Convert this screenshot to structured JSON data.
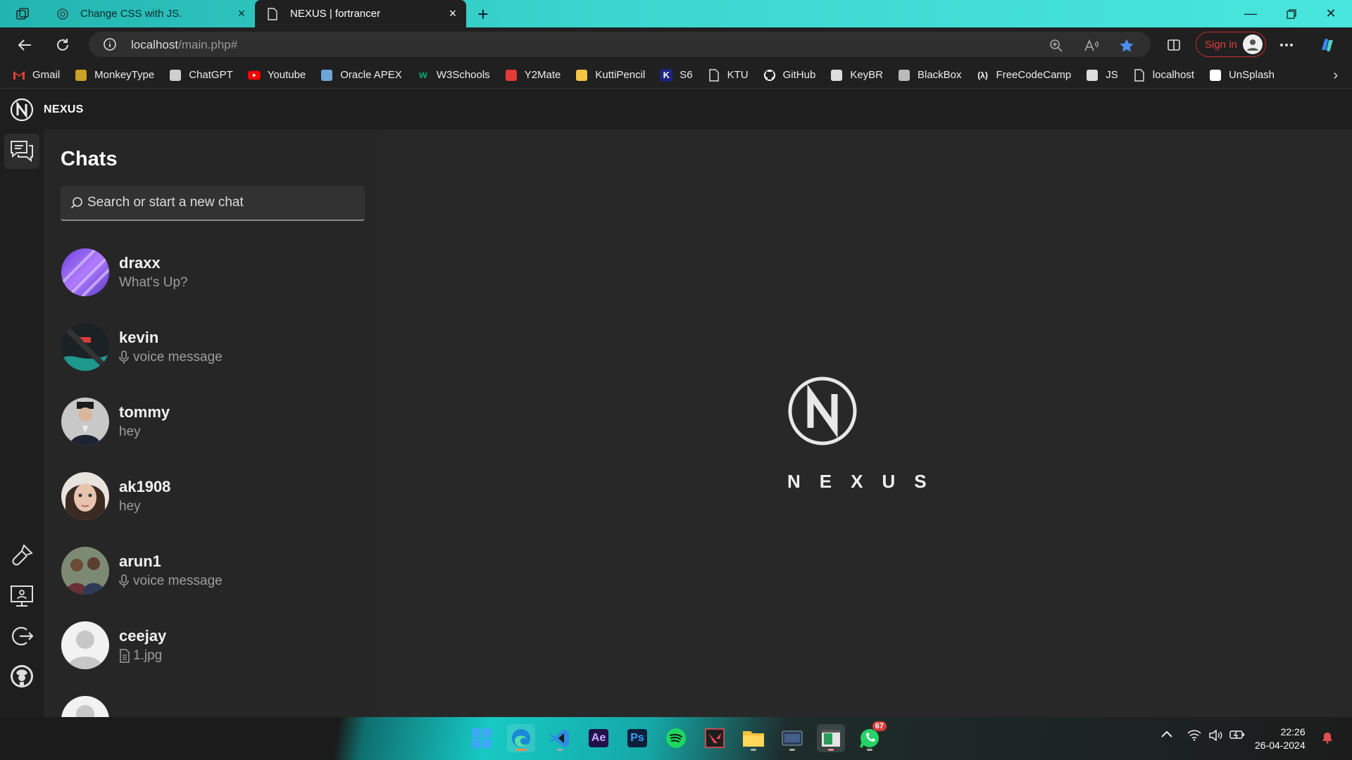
{
  "browser": {
    "tabs": [
      {
        "title": "Change CSS with JS.",
        "favicon": "chatgpt-icon"
      },
      {
        "title": "NEXUS | fortrancer",
        "favicon": "page-icon"
      }
    ],
    "url_host": "localhost",
    "url_path": "/main.php#",
    "signin_label": "Sign in",
    "bookmarks": [
      {
        "label": "Gmail",
        "icon": "gmail-icon",
        "color": "#ea4335"
      },
      {
        "label": "MonkeyType",
        "icon": "monkeytype-icon",
        "color": "#c9a227"
      },
      {
        "label": "ChatGPT",
        "icon": "chatgpt-icon",
        "color": "#cfcfcf"
      },
      {
        "label": "Youtube",
        "icon": "youtube-icon",
        "color": "#ff0000"
      },
      {
        "label": "Oracle APEX",
        "icon": "oracle-apex-icon",
        "color": "#6aa6d8"
      },
      {
        "label": "W3Schools",
        "icon": "w3schools-icon",
        "color": "#04aa6d"
      },
      {
        "label": "Y2Mate",
        "icon": "y2mate-icon",
        "color": "#e53935"
      },
      {
        "label": "KuttiPencil",
        "icon": "pencil-icon",
        "color": "#f4c542"
      },
      {
        "label": "S6",
        "icon": "k-icon",
        "color": "#1a237e"
      },
      {
        "label": "KTU",
        "icon": "page-icon",
        "color": "#dddddd"
      },
      {
        "label": "GitHub",
        "icon": "github-icon",
        "color": "#ffffff"
      },
      {
        "label": "KeyBR",
        "icon": "keybr-icon",
        "color": "#dddddd"
      },
      {
        "label": "BlackBox",
        "icon": "blackbox-icon",
        "color": "#bbbbbb"
      },
      {
        "label": "FreeCodeCamp",
        "icon": "freecodecamp-icon",
        "color": "#ffffff"
      },
      {
        "label": "JS",
        "icon": "js-icon",
        "color": "#dddddd"
      },
      {
        "label": "localhost",
        "icon": "page-icon",
        "color": "#dddddd"
      },
      {
        "label": "UnSplash",
        "icon": "unsplash-icon",
        "color": "#ffffff"
      }
    ]
  },
  "app": {
    "brand": "NEXUS",
    "panel_title": "Chats",
    "search_placeholder": "Search or start a new chat",
    "hero_word": "NEXUS",
    "chats": [
      {
        "name": "draxx",
        "message": "What's Up?",
        "type": "text",
        "avatar": "purple-abstract"
      },
      {
        "name": "kevin",
        "message": "voice message",
        "type": "voice",
        "avatar": "dark-teal"
      },
      {
        "name": "tommy",
        "message": "hey",
        "type": "text",
        "avatar": "man-suit"
      },
      {
        "name": "ak1908",
        "message": "hey",
        "type": "text",
        "avatar": "woman-face"
      },
      {
        "name": "arun1",
        "message": "voice message",
        "type": "voice",
        "avatar": "two-people"
      },
      {
        "name": "ceejay",
        "message": "1.jpg",
        "type": "file",
        "avatar": "default"
      }
    ]
  },
  "taskbar": {
    "whatsapp_badge": "67",
    "time": "22:26",
    "date": "26-04-2024"
  },
  "colors": {
    "accent_teal": "#3cd6cf",
    "signin_red": "#e03b3b",
    "app_bg": "#282828",
    "panel_bg": "#262626"
  }
}
